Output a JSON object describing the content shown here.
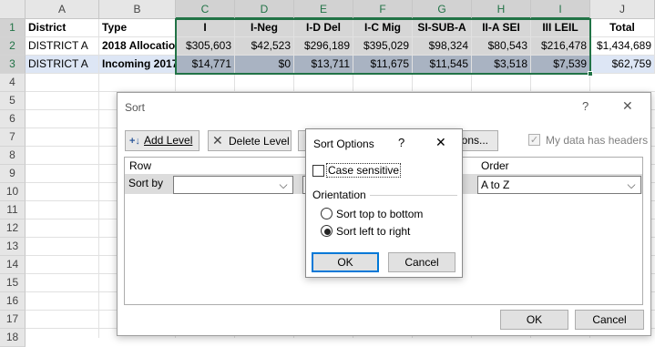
{
  "columns": [
    "A",
    "B",
    "C",
    "D",
    "E",
    "F",
    "G",
    "H",
    "I",
    "J"
  ],
  "rows": [
    "1",
    "2",
    "3",
    "4",
    "5",
    "6",
    "7",
    "8",
    "9",
    "10",
    "11",
    "12",
    "13",
    "14",
    "15",
    "16",
    "17",
    "18"
  ],
  "header_row": [
    "District",
    "Type",
    "I",
    "I-Neg",
    "I-D Del",
    "I-C Mig",
    "SI-SUB-A",
    "II-A SEI",
    "III LEIL",
    "Total"
  ],
  "row2": [
    "DISTRICT A",
    "2018 Allocatio",
    "$305,603",
    "$42,523",
    "$296,189",
    "$395,029",
    "$98,324",
    "$80,543",
    "$216,478",
    "$1,434,689"
  ],
  "row3": [
    "DISTRICT A",
    "Incoming 2017",
    "$14,771",
    "$0",
    "$13,711",
    "$11,675",
    "$11,545",
    "$3,518",
    "$7,539",
    "$62,759"
  ],
  "sort_dialog": {
    "title": "Sort",
    "help": "?",
    "close": "✕",
    "add_level": "Add Level",
    "delete_level": "Delete Level",
    "options_partial": "ions...",
    "my_data_has_headers": "My data has headers",
    "col_row": "Row",
    "col_order": "Order",
    "sort_by": "Sort by",
    "order_value": "A to Z",
    "ok": "OK",
    "cancel": "Cancel"
  },
  "options_dialog": {
    "title": "Sort Options",
    "help": "?",
    "close": "✕",
    "case_sensitive": "Case sensitive",
    "orientation": "Orientation",
    "top_to_bottom": "Sort top to bottom",
    "left_to_right": "Sort left to right",
    "selected_orientation": "left_to_right",
    "ok": "OK",
    "cancel": "Cancel"
  },
  "colors": {
    "accent": "#217346",
    "selection_gray": "#d6d6d6",
    "selection_dark": "#a9b3c2"
  }
}
